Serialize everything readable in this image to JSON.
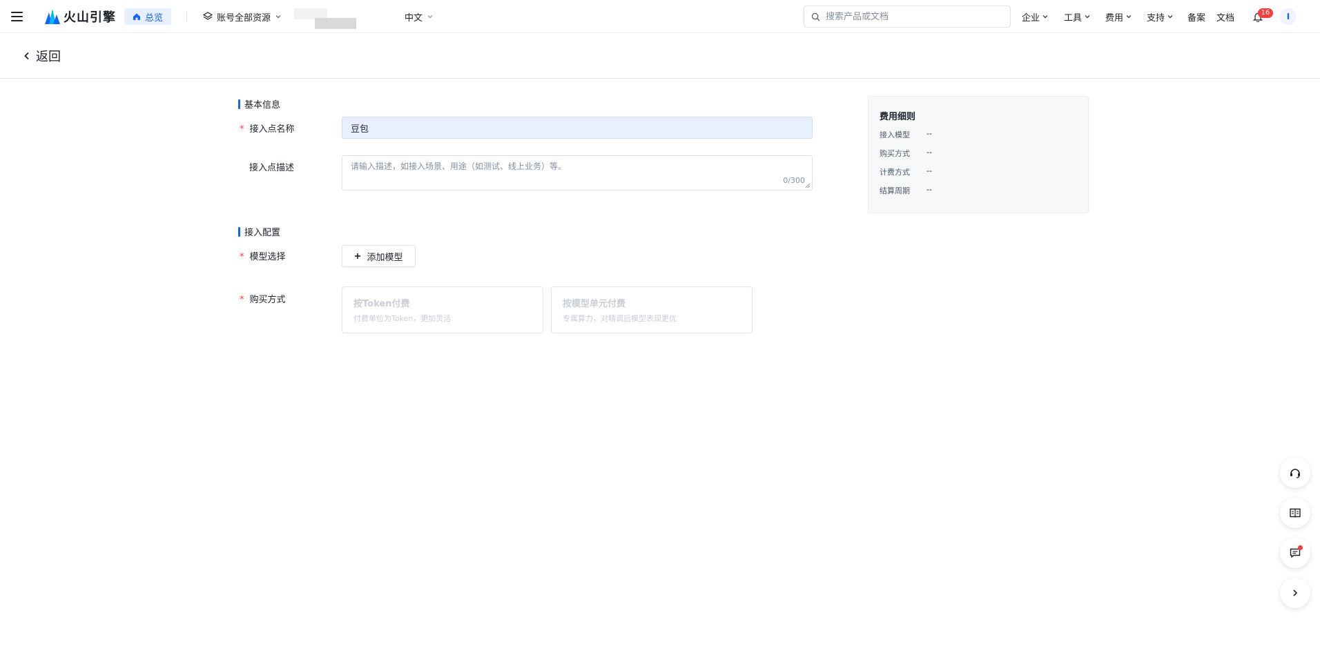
{
  "topbar": {
    "brand": "火山引擎",
    "overview_label": "总览",
    "resources_label": "账号全部资源",
    "language_label": "中文",
    "search_placeholder": "搜索产品或文档",
    "nav": {
      "enterprise": "企业",
      "tools": "工具",
      "billing": "费用",
      "support": "支持",
      "filing": "备案",
      "docs": "文档"
    },
    "notification_count": "16",
    "avatar_initial": "I",
    "accent_color": "#1664ff"
  },
  "subheader": {
    "back_label": "返回"
  },
  "form": {
    "basic_section_title": "基本信息",
    "name_label": "接入点名称",
    "name_value": "豆包",
    "desc_label": "接入点描述",
    "desc_placeholder": "请输入描述，如接入场景、用途（如测试、线上业务）等。",
    "desc_counter": "0/300",
    "config_section_title": "接入配置",
    "model_label": "模型选择",
    "add_model_label": "添加模型",
    "purchase_label": "购买方式",
    "purchase_options": [
      {
        "title": "按Token付费",
        "desc": "付费单位为Token，更加灵活"
      },
      {
        "title": "按模型单元付费",
        "desc": "专属算力，对精调后模型表现更优"
      }
    ]
  },
  "fee_panel": {
    "title": "费用细则",
    "rows": [
      {
        "key": "接入模型",
        "value": "--"
      },
      {
        "key": "购买方式",
        "value": "--"
      },
      {
        "key": "计费方式",
        "value": "--"
      },
      {
        "key": "结算周期",
        "value": "--"
      }
    ]
  },
  "float_buttons": [
    "headset-icon",
    "book-icon",
    "feedback-icon",
    "chevron-right-icon"
  ]
}
